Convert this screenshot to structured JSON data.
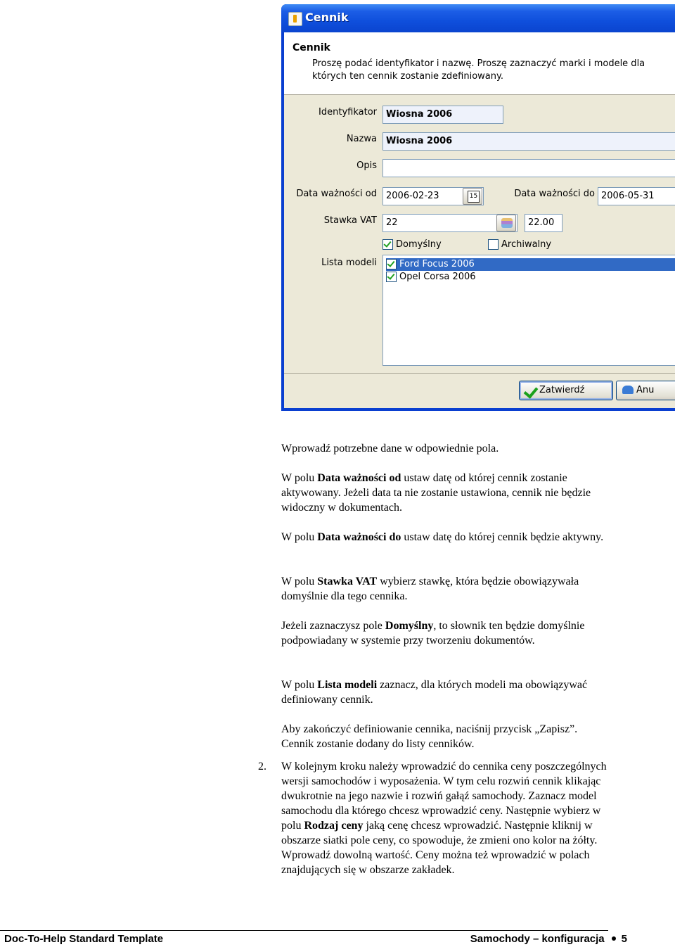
{
  "dialog": {
    "title": "Cennik",
    "header_title": "Cennik",
    "header_desc": "Proszę podać identyfikator i nazwę. Proszę zaznaczyć marki i modele dla których ten cennik zostanie zdefiniowany.",
    "labels": {
      "identyfikator": "Identyfikator",
      "nazwa": "Nazwa",
      "opis": "Opis",
      "data_od": "Data ważności od",
      "data_do": "Data ważności do",
      "stawka": "Stawka VAT",
      "lista": "Lista modeli"
    },
    "values": {
      "identyfikator": "Wiosna 2006",
      "nazwa": "Wiosna 2006",
      "opis": "",
      "data_od": "2006-02-23",
      "data_do": "2006-05-31",
      "stawka": "22",
      "stawka_value": "22.00",
      "cal_day": "15"
    },
    "checkboxes": {
      "domyslny": "Domyślny",
      "archiwalny": "Archiwalny"
    },
    "models": [
      "Ford Focus 2006",
      "Opel Corsa 2006"
    ],
    "buttons": {
      "zatwierdz": "Zatwierdź",
      "anuluj": "Anu"
    }
  },
  "doc": {
    "p1": "Wprowadź potrzebne dane w odpowiednie pola.",
    "p2_a": "W polu ",
    "p2_b": "Data ważności od",
    "p2_c": " ustaw datę od której cennik zostanie aktywowany. Jeżeli data ta nie zostanie ustawiona, cennik nie będzie widoczny w dokumentach.",
    "p3_a": "W polu ",
    "p3_b": "Data ważności do",
    "p3_c": " ustaw datę do której cennik będzie aktywny.",
    "p4_a": "W polu ",
    "p4_b": "Stawka VAT",
    "p4_c": " wybierz stawkę, która będzie obowiązywała domyślnie dla tego cennika.",
    "p5_a": "Jeżeli zaznaczysz pole ",
    "p5_b": "Domyślny",
    "p5_c": ", to słownik ten będzie domyślnie podpowiadany w systemie przy tworzeniu dokumentów.",
    "p6_a": "W polu ",
    "p6_b": "Lista modeli",
    "p6_c": " zaznacz, dla których modeli ma obowiązywać definiowany cennik.",
    "p7": "Aby zakończyć definiowanie cennika, naciśnij przycisk „Zapisz”. Cennik zostanie dodany do listy cenników.",
    "num2": "2.",
    "p8_a": "W kolejnym kroku należy wprowadzić do cennika ceny poszczególnych wersji samochodów i wyposażenia. W tym celu rozwiń cennik klikając dwukrotnie na jego nazwie i rozwiń gałąź samochody. Zaznacz model samochodu dla którego chcesz wprowadzić ceny. Następnie wybierz w polu ",
    "p8_b": "Rodzaj ceny",
    "p8_c": " jaką cenę chcesz wprowadzić. Następnie kliknij w obszarze siatki pole ceny, co spowoduje, że zmieni ono kolor na żółty. Wprowadź dowolną wartość. Ceny można też wprowadzić w polach znajdujących się w obszarze zakładek."
  },
  "footer": {
    "left": "Doc-To-Help Standard Template",
    "right": "Samochody – konfiguracja",
    "page": "5"
  }
}
